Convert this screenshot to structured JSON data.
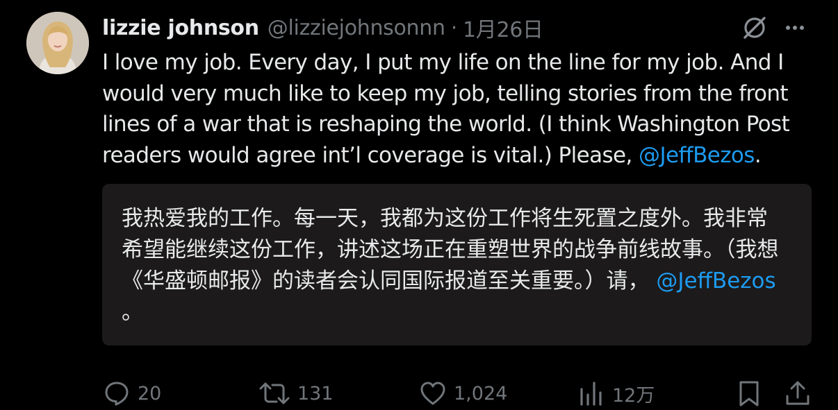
{
  "tweet": {
    "author": {
      "display_name": "lizzie johnson",
      "handle": "@lizziejohnsonnn",
      "avatar_icon": "profile-photo"
    },
    "separator": "·",
    "date": "1月26日",
    "text_before_mention": "I love my job. Every day, I put my life on the line for my job. And I would very much like to keep my job, telling stories from the front lines of a war that is reshaping the world. (I think Washington Post readers would agree int’l coverage is vital.) Please, ",
    "mention": "@JeffBezos",
    "text_after_mention": ".",
    "translation": {
      "text_before_mention": "我热爱我的工作。每一天，我都为这份工作将生死置之度外。我非常希望能继续这份工作，讲述这场正在重塑世界的战争前线故事。（我想《华盛顿邮报》的读者会认同国际报道至关重要。）请，",
      "mention": "@JeffBezos",
      "text_after_mention": "。"
    },
    "actions": {
      "reply_count": "20",
      "repost_count": "131",
      "like_count": "1,024",
      "views_count": "12万"
    }
  },
  "colors": {
    "background": "#000000",
    "text": "#e7e9ea",
    "secondary": "#71767b",
    "link": "#1d9bf0",
    "translation_box": "#1c1a1a"
  },
  "icons": {
    "grok": "grok-icon",
    "more": "more-icon",
    "reply": "reply-icon",
    "repost": "repost-icon",
    "like": "heart-icon",
    "views": "views-icon",
    "bookmark": "bookmark-icon",
    "share": "share-icon"
  }
}
